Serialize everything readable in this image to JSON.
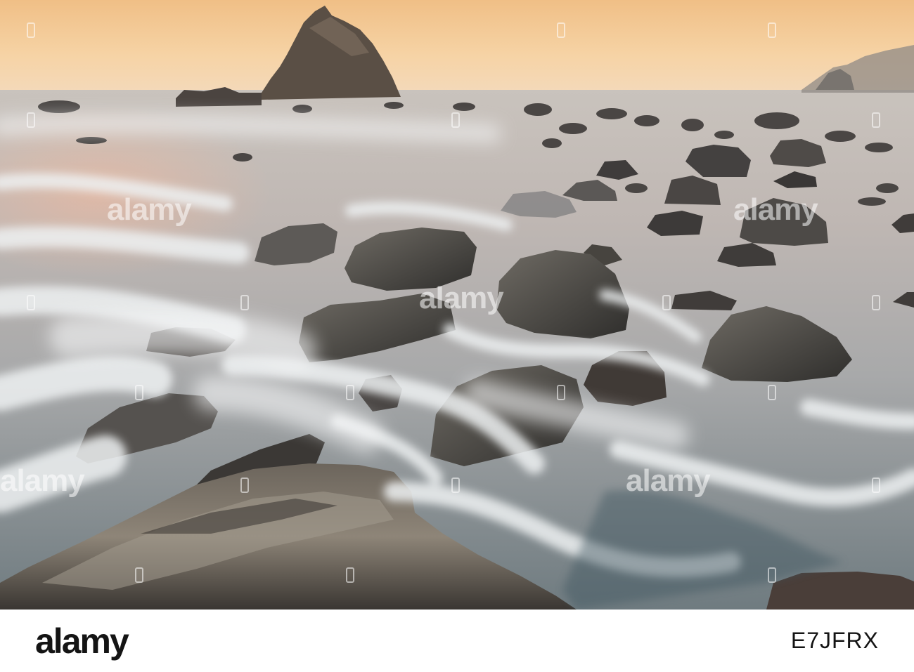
{
  "image": {
    "subject": "rocky shoreline at sunset with sea stack and long-exposure surf",
    "palette": {
      "sky_top": "#f3c58c",
      "sky_horizon": "#f7d9ae",
      "sea_far": "#c8c2bc",
      "sea_near": "#7f8c90",
      "rock_dark": "#3b3a38",
      "rock_light": "#8f8b82",
      "foam": "#eef1f2"
    }
  },
  "watermark": {
    "text": "alamy"
  },
  "footer": {
    "logo_text": "alamy",
    "image_id": "E7JFRX"
  }
}
